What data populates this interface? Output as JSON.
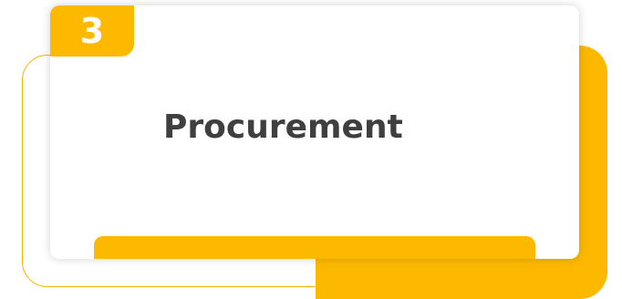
{
  "card": {
    "number": "3",
    "title": "Procurement"
  },
  "colors": {
    "accent": "#FDB800",
    "outline": "#F5B400",
    "title_text": "#3F3F3F",
    "card_background": "#FFFFFF"
  }
}
